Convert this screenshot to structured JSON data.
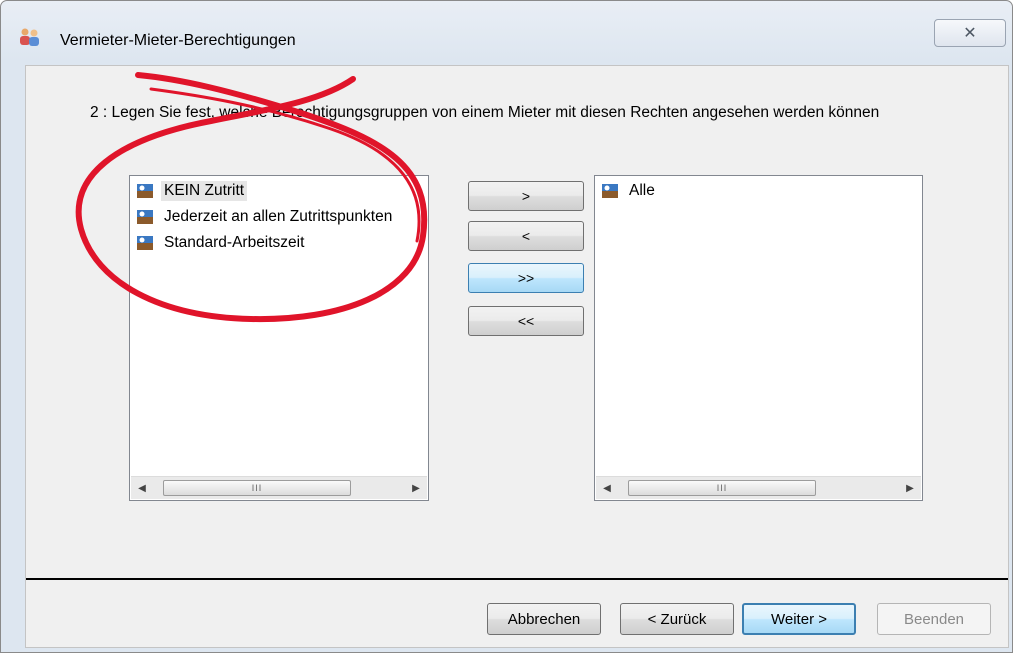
{
  "window": {
    "title": "Vermieter-Mieter-Berechtigungen",
    "close_glyph": "✕"
  },
  "instruction": "2 : Legen Sie fest, welche Berechtigungsgruppen von einem Mieter mit diesen Rechten angesehen werden können",
  "available_list": {
    "items": [
      {
        "label": "KEIN Zutritt",
        "icon": "door-group-icon",
        "selected": true
      },
      {
        "label": "Jederzeit an allen Zutrittspunkten",
        "icon": "door-group-icon",
        "selected": false
      },
      {
        "label": "Standard-Arbeitszeit",
        "icon": "door-group-icon",
        "selected": false
      }
    ]
  },
  "assigned_list": {
    "items": [
      {
        "label": "Alle",
        "icon": "door-group-icon",
        "selected": false
      }
    ]
  },
  "move_buttons": {
    "add_selected": ">",
    "remove_selected": "<",
    "add_all": ">>",
    "remove_all": "<<"
  },
  "scrollbar": {
    "left_arrow": "◀",
    "right_arrow": "▶",
    "grip": "III"
  },
  "footer": {
    "cancel_label": "Abbrechen",
    "back_label": "< Zurück",
    "next_label": "Weiter >",
    "finish_label": "Beenden"
  },
  "colors": {
    "annotation_red": "#e0142a",
    "hot_button_border": "#3c7fb1"
  }
}
